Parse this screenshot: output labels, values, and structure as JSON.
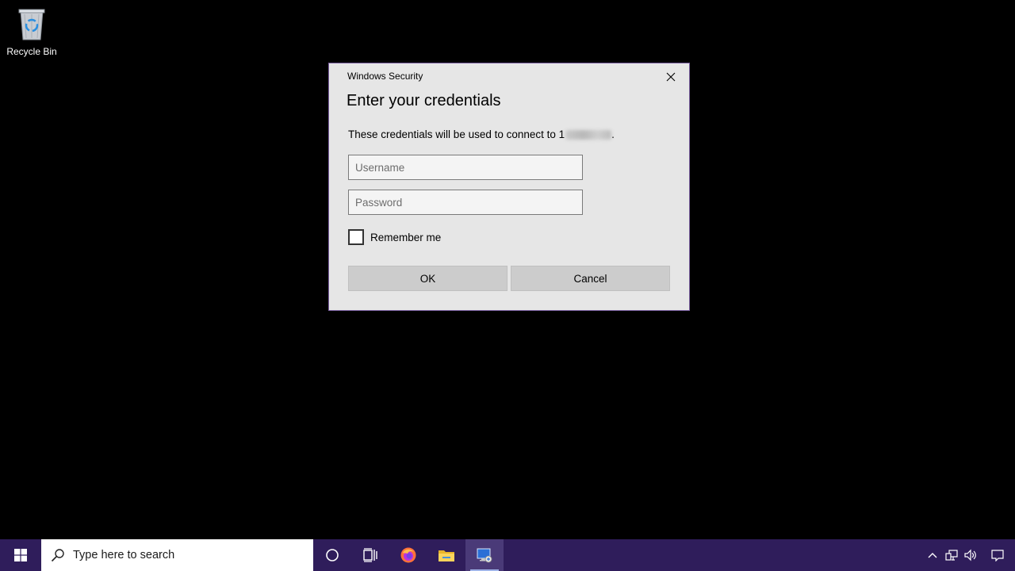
{
  "desktop": {
    "recycle_bin_label": "Recycle Bin"
  },
  "dialog": {
    "app_title": "Windows Security",
    "heading": "Enter your credentials",
    "message_prefix": "These credentials will be used to connect to 1",
    "message_suffix": ".",
    "username_placeholder": "Username",
    "username_value": "",
    "password_placeholder": "Password",
    "password_value": "",
    "remember_label": "Remember me",
    "remember_checked": false,
    "ok_label": "OK",
    "cancel_label": "Cancel"
  },
  "taskbar": {
    "search_placeholder": "Type here to search",
    "pinned": [
      "cortana-icon",
      "task-view-icon",
      "firefox-icon",
      "file-explorer-icon",
      "remote-desktop-icon"
    ],
    "tray": [
      "chevron-up-icon",
      "network-icon",
      "volume-icon",
      "notification-icon"
    ]
  },
  "colors": {
    "taskbar": "#2f1d5b",
    "dialog_bg": "#e6e6e6",
    "dialog_border": "#7a5fa0",
    "button_bg": "#cccccc",
    "desktop_bg": "#000000"
  }
}
